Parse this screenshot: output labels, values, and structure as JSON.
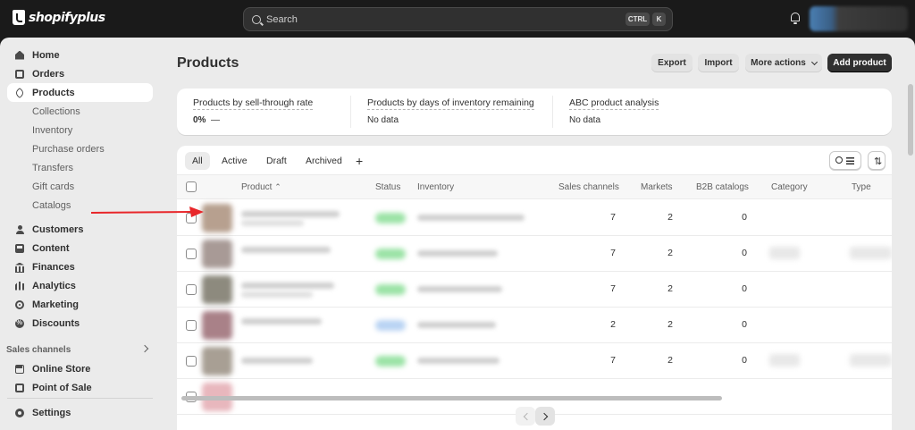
{
  "app": {
    "brand": "shopifyplus"
  },
  "search": {
    "placeholder": "Search",
    "shortcut_ctrl": "CTRL",
    "shortcut_key": "K"
  },
  "sidebar": {
    "items": [
      {
        "label": "Home",
        "icon": "home-icon"
      },
      {
        "label": "Orders",
        "icon": "orders-icon"
      },
      {
        "label": "Products",
        "icon": "tag-icon",
        "active": true
      }
    ],
    "product_subitems": [
      "Collections",
      "Inventory",
      "Purchase orders",
      "Transfers",
      "Gift cards",
      "Catalogs"
    ],
    "more_items": [
      {
        "label": "Customers",
        "icon": "person-icon"
      },
      {
        "label": "Content",
        "icon": "content-icon"
      },
      {
        "label": "Finances",
        "icon": "bank-icon"
      },
      {
        "label": "Analytics",
        "icon": "bar-chart-icon"
      },
      {
        "label": "Marketing",
        "icon": "target-icon"
      },
      {
        "label": "Discounts",
        "icon": "discount-icon"
      }
    ],
    "sales_channels_label": "Sales channels",
    "channels": [
      {
        "label": "Online Store",
        "icon": "store-icon"
      },
      {
        "label": "Point of Sale",
        "icon": "pos-icon"
      }
    ],
    "settings_label": "Settings"
  },
  "header": {
    "title": "Products",
    "export_label": "Export",
    "import_label": "Import",
    "more_actions_label": "More actions",
    "add_product_label": "Add product"
  },
  "metrics": [
    {
      "title": "Products by sell-through rate",
      "value": "0%",
      "suffix": "—"
    },
    {
      "title": "Products by days of inventory remaining",
      "value": "No data"
    },
    {
      "title": "ABC product analysis",
      "value": "No data"
    }
  ],
  "tabs": [
    "All",
    "Active",
    "Draft",
    "Archived"
  ],
  "add_tab_label": "+",
  "table": {
    "columns": {
      "product": "Product",
      "status": "Status",
      "inventory": "Inventory",
      "sales_channels": "Sales channels",
      "markets": "Markets",
      "b2b_catalogs": "B2B catalogs",
      "category": "Category",
      "type": "Type"
    },
    "rows": [
      {
        "sales_channels": "7",
        "markets": "2",
        "b2b_catalogs": "0",
        "thumb_color": "#b7a08f",
        "status_color": "#9be3a6"
      },
      {
        "sales_channels": "7",
        "markets": "2",
        "b2b_catalogs": "0",
        "thumb_color": "#a89a96",
        "status_color": "#9be3a6"
      },
      {
        "sales_channels": "7",
        "markets": "2",
        "b2b_catalogs": "0",
        "thumb_color": "#8d8a7e",
        "status_color": "#9be3a6"
      },
      {
        "sales_channels": "2",
        "markets": "2",
        "b2b_catalogs": "0",
        "thumb_color": "#a98188",
        "status_color": "#b9d3f3"
      },
      {
        "sales_channels": "7",
        "markets": "2",
        "b2b_catalogs": "0",
        "thumb_color": "#a89f94",
        "status_color": "#9be3a6"
      }
    ]
  },
  "colors": {
    "accent_arrow": "#e8262a",
    "active_status": "#9be3a6",
    "draft_status": "#b9d3f3"
  }
}
